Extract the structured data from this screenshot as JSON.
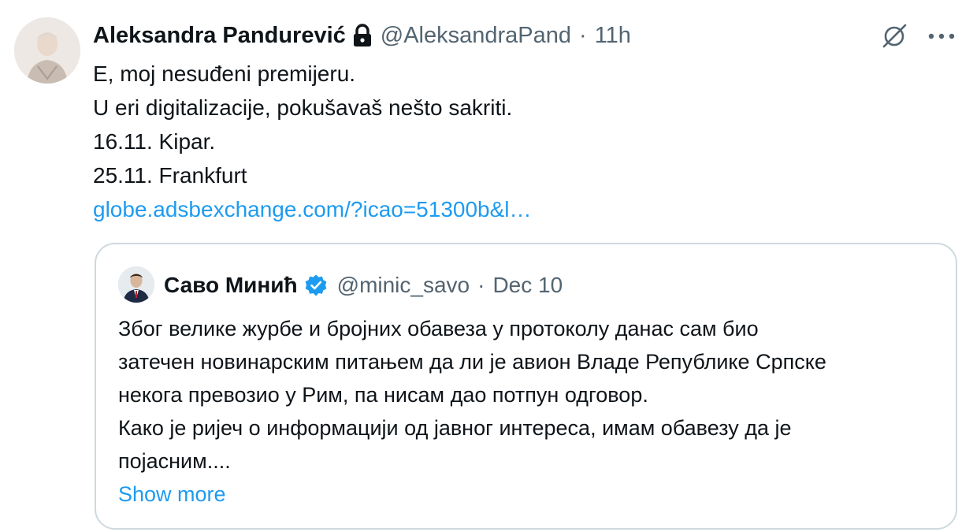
{
  "tweet": {
    "author_name": "Aleksandra Pandurević",
    "handle": "@AleksandraPand",
    "separator": "·",
    "time": "11h",
    "icons": {
      "lock": "lock-icon",
      "grok": "grok-icon",
      "more": "more-icon",
      "avatar": "avatar"
    },
    "lines": [
      "E, moj nesuđeni premijeru.",
      "U eri digitalizacije, pokušavaš nešto sakriti.",
      "16.11. Kipar.",
      "25.11. Frankfurt"
    ],
    "link_text": "globe.adsbexchange.com/?icao=51300b&l…"
  },
  "quote": {
    "author_name": "Саво Минић",
    "handle": "@minic_savo",
    "separator": "·",
    "date": "Dec 10",
    "lines": [
      "Због велике журбе и бројних обавеза у протоколу данас сам био",
      "затечен новинарским питањем да ли је авион Владе Републике Српске",
      "некога превозио у Рим, па нисам дао потпун одговор.",
      "Како је ријеч о информацији од јавног интереса, имам обавезу да је",
      "појасним...."
    ],
    "show_more": "Show more",
    "icons": {
      "verified": "verified-badge-icon"
    }
  },
  "colors": {
    "link": "#1d9bf0",
    "secondary": "#536471",
    "border": "#cfd9de",
    "text": "#0f1419"
  }
}
